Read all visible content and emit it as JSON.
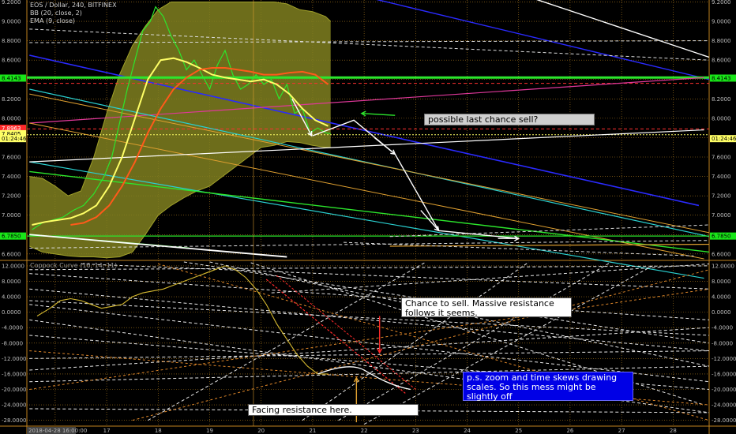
{
  "chart_data": {
    "type": "line",
    "header": {
      "symbol_line": "EOS / Dollar, 240, BITFINEX",
      "bb_line": "BB (20, close, 2)",
      "ema_line": "EMA (9, close)"
    },
    "price_axis": {
      "ticks": [
        "9.2000",
        "9.0000",
        "8.8000",
        "8.6000",
        "8.4000",
        "8.2000",
        "8.0000",
        "7.8000",
        "7.6000",
        "7.4000",
        "7.2000",
        "7.0000",
        "6.8000",
        "6.6000"
      ],
      "tick_values": [
        9.2,
        9.0,
        8.8,
        8.6,
        8.4,
        8.2,
        8.0,
        7.8,
        7.6,
        7.4,
        7.2,
        7.0,
        6.8,
        6.6
      ],
      "ylim": [
        6.55,
        9.22
      ]
    },
    "coppock": {
      "label": "Coppock Curve (10, 14, 11)",
      "ticks": [
        "12.0000",
        "8.0000",
        "4.0000",
        "0.0000",
        "-4.0000",
        "-8.0000",
        "-12.0000",
        "-16.0000",
        "-20.0000",
        "-24.0000",
        "-28.0000"
      ],
      "tick_values": [
        12,
        8,
        4,
        0,
        -4,
        -8,
        -12,
        -16,
        -20,
        -24,
        -28
      ],
      "ylim": [
        -29.5,
        13
      ],
      "x": [
        15.65,
        15.9,
        16.1,
        16.3,
        16.5,
        16.7,
        16.9,
        17.1,
        17.3,
        17.5,
        17.7,
        17.9,
        18.1,
        18.3,
        18.5,
        18.7,
        18.9,
        19.1,
        19.3,
        19.5,
        19.7,
        19.9,
        20.1,
        20.3,
        20.5,
        20.7,
        20.9,
        21.1,
        21.3
      ],
      "values": [
        -1,
        1,
        3,
        3.5,
        3,
        2,
        1,
        1.5,
        2,
        4,
        5,
        5.5,
        6,
        7,
        8,
        9,
        10,
        11,
        12,
        11,
        9,
        6,
        2,
        -3,
        -7,
        -11,
        -14,
        -16,
        -16
      ]
    },
    "price_tags": [
      {
        "text": "8.4143",
        "value": 8.4143,
        "side": "both",
        "color": "#19e619"
      },
      {
        "text": "7.8963",
        "value": 7.8963,
        "side": "left",
        "color": "#ff2a2a"
      },
      {
        "text": "7.8405",
        "value": 7.8405,
        "side": "left",
        "color": "#ffff66"
      },
      {
        "text": "01:24:46",
        "value": 7.79,
        "side": "both",
        "color": "#ffff66"
      },
      {
        "text": "6.7850",
        "value": 6.785,
        "side": "both",
        "color": "#19e619"
      }
    ],
    "x_axis": {
      "ticks": [
        "16",
        "17",
        "18",
        "19",
        "20",
        "21",
        "22",
        "23",
        "24",
        "25",
        "26",
        "27",
        "28"
      ],
      "tick_values": [
        16,
        17,
        18,
        19,
        20,
        21,
        22,
        23,
        24,
        25,
        26,
        27,
        28
      ],
      "xlim": [
        15.45,
        28.7
      ],
      "cursor_label": "2018-04-28 16:00:00",
      "cursor_value": 21.65
    },
    "bands": {
      "x": [
        15.5,
        15.75,
        16.0,
        16.25,
        16.5,
        16.75,
        17.0,
        17.25,
        17.5,
        17.75,
        18.0,
        18.25,
        18.5,
        18.75,
        19.0,
        19.25,
        19.5,
        19.75,
        20.0,
        20.25,
        20.5,
        20.75,
        21.0,
        21.25,
        21.35
      ],
      "upper": [
        7.4,
        7.38,
        7.3,
        7.2,
        7.25,
        7.6,
        8.05,
        8.45,
        8.75,
        8.95,
        9.12,
        9.2,
        9.2,
        9.2,
        9.2,
        9.2,
        9.2,
        9.2,
        9.2,
        9.2,
        9.18,
        9.12,
        9.1,
        9.05,
        9.0
      ],
      "lower": [
        6.68,
        6.62,
        6.6,
        6.58,
        6.57,
        6.57,
        6.56,
        6.57,
        6.62,
        6.8,
        7.0,
        7.1,
        7.18,
        7.25,
        7.3,
        7.4,
        7.5,
        7.6,
        7.7,
        7.72,
        7.76,
        7.75,
        7.72,
        7.7,
        7.7
      ]
    },
    "series": [
      {
        "color": "#2ce62c",
        "x": [
          15.55,
          15.75,
          15.95,
          16.15,
          16.35,
          16.55,
          16.75,
          16.95,
          17.1,
          17.25,
          17.4,
          17.55,
          17.7,
          17.85,
          17.95,
          18.1,
          18.25,
          18.4,
          18.55,
          18.7,
          18.85,
          19.0,
          19.15,
          19.3,
          19.45,
          19.6,
          19.75,
          19.9,
          20.05,
          20.2,
          20.35,
          20.5,
          20.65,
          20.8,
          20.95,
          21.1,
          21.25,
          21.35
        ],
        "values": [
          6.85,
          6.92,
          6.95,
          6.98,
          7.05,
          7.1,
          7.22,
          7.4,
          7.6,
          7.95,
          8.3,
          8.6,
          8.9,
          9.0,
          9.15,
          9.05,
          8.85,
          8.7,
          8.5,
          8.6,
          8.45,
          8.3,
          8.55,
          8.7,
          8.45,
          8.3,
          8.35,
          8.45,
          8.35,
          8.4,
          8.2,
          8.35,
          8.05,
          8.1,
          7.85,
          7.9,
          7.85,
          7.84
        ]
      },
      {
        "color": "#ffff66",
        "x": [
          15.55,
          15.8,
          16.05,
          16.3,
          16.55,
          16.8,
          17.05,
          17.3,
          17.55,
          17.8,
          18.05,
          18.3,
          18.55,
          18.8,
          19.05,
          19.3,
          19.55,
          19.8,
          20.05,
          20.3,
          20.55,
          20.8,
          21.05,
          21.3
        ],
        "values": [
          6.9,
          6.93,
          6.95,
          6.97,
          7.02,
          7.1,
          7.3,
          7.6,
          8.0,
          8.4,
          8.6,
          8.62,
          8.58,
          8.52,
          8.45,
          8.42,
          8.4,
          8.38,
          8.4,
          8.35,
          8.25,
          8.1,
          7.98,
          7.92
        ]
      },
      {
        "color": "#ff5a1a",
        "x": [
          16.3,
          16.55,
          16.8,
          17.05,
          17.3,
          17.55,
          17.8,
          18.05,
          18.3,
          18.55,
          18.8,
          19.05,
          19.3,
          19.55,
          19.8,
          20.05,
          20.3,
          20.55,
          20.8,
          21.05,
          21.3
        ],
        "values": [
          6.9,
          6.92,
          6.98,
          7.1,
          7.3,
          7.55,
          7.85,
          8.1,
          8.3,
          8.42,
          8.5,
          8.52,
          8.52,
          8.5,
          8.48,
          8.45,
          8.45,
          8.47,
          8.48,
          8.45,
          8.35
        ]
      }
    ],
    "annotations": [
      {
        "text": "possible last chance sell?"
      },
      {
        "text": "Chance to sell. Massive resistance follows it seems."
      },
      {
        "text": "p.s. zoom and time skews drawing scales. So this mess might be slightly off"
      },
      {
        "text": "Facing resistance here."
      }
    ],
    "grid": true
  }
}
